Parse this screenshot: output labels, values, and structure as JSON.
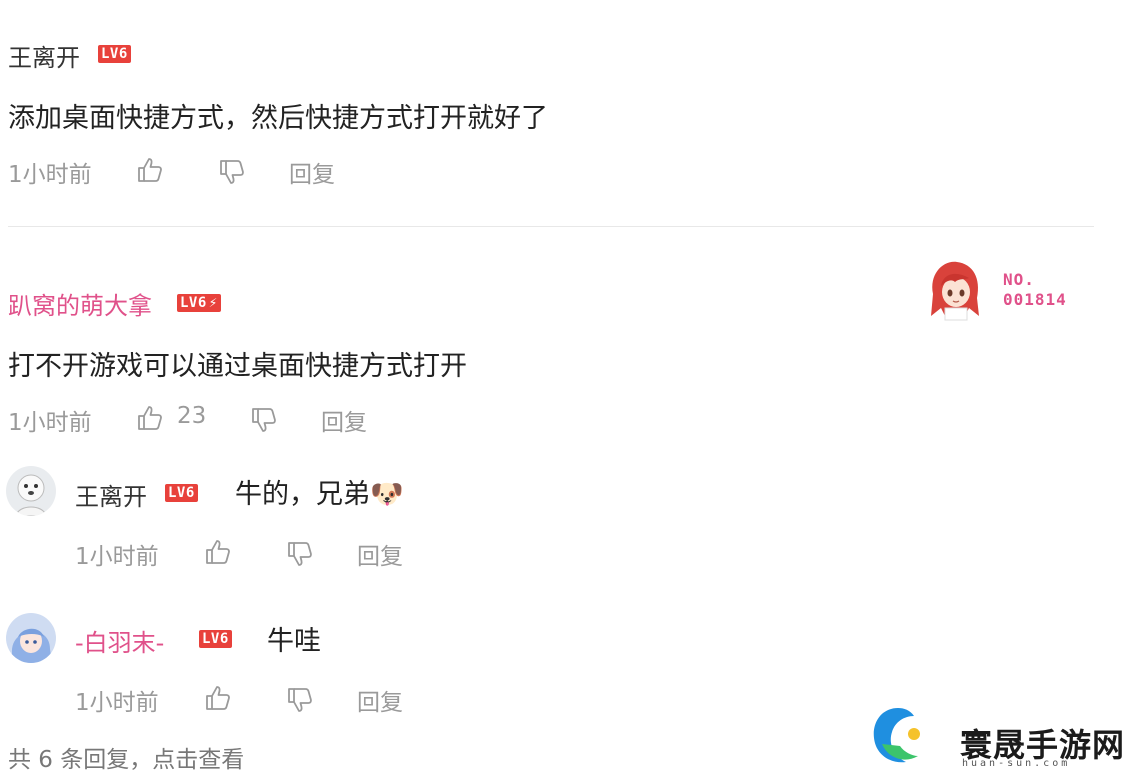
{
  "comments": [
    {
      "username": "王离开",
      "level": "LV6",
      "content": "添加桌面快捷方式，然后快捷方式打开就好了",
      "time": "1小时前",
      "like_count": "",
      "reply_label": "回复"
    },
    {
      "username": "趴窝的萌大拿",
      "level": "LV6",
      "level_bolt": "⚡",
      "content": "打不开游戏可以通过桌面快捷方式打开",
      "time": "1小时前",
      "like_count": "23",
      "reply_label": "回复",
      "card_no_label": "NO.",
      "card_no": "001814",
      "replies": [
        {
          "username": "王离开",
          "level": "LV6",
          "content": "牛的，兄弟",
          "emoji": "🐶",
          "time": "1小时前",
          "reply_label": "回复"
        },
        {
          "username": "-白羽末-",
          "level": "LV6",
          "content": "牛哇",
          "time": "1小时前",
          "reply_label": "回复"
        }
      ],
      "view_more": "共 6 条回复，点击查看"
    }
  ],
  "watermark": {
    "brand": "寰晟手游网",
    "url": "huan-sun.com"
  },
  "colors": {
    "level_badge": "#e8413b",
    "pink_username": "#e0518a",
    "meta_gray": "#9a9a9a"
  }
}
